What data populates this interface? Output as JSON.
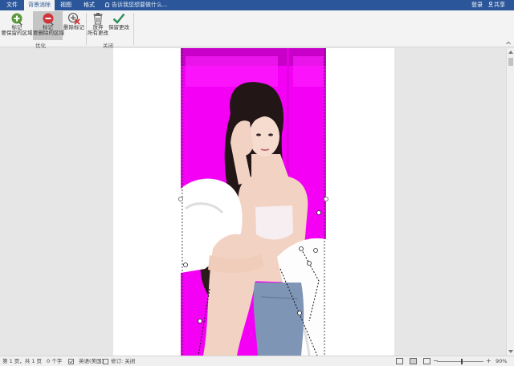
{
  "tabs": [
    {
      "label": "文件",
      "active": false
    },
    {
      "label": "背景消除",
      "active": true
    },
    {
      "label": "视图",
      "active": false
    },
    {
      "label": "格式",
      "active": false
    }
  ],
  "tell_me": {
    "placeholder": "告诉我您想要做什么..."
  },
  "account": {
    "login": "登录",
    "share": "共享"
  },
  "ribbon": {
    "refine": {
      "label": "优化",
      "mark_keep": [
        "标记",
        "要保留的区域"
      ],
      "mark_remove": [
        "标记",
        "要删除的区域"
      ],
      "delete_mark": "删除标记"
    },
    "close": {
      "label": "关闭",
      "discard": [
        "放弃",
        "所有更改"
      ],
      "keep": "保留更改"
    }
  },
  "status": {
    "page": "第 1 页，共 1 页",
    "words": "0 个字",
    "language": "英语(美国)",
    "track": "修订: 关闭",
    "zoom": "90%"
  },
  "colors": {
    "accent": "#2b579a",
    "removal_overlay": "#ff00ff"
  }
}
